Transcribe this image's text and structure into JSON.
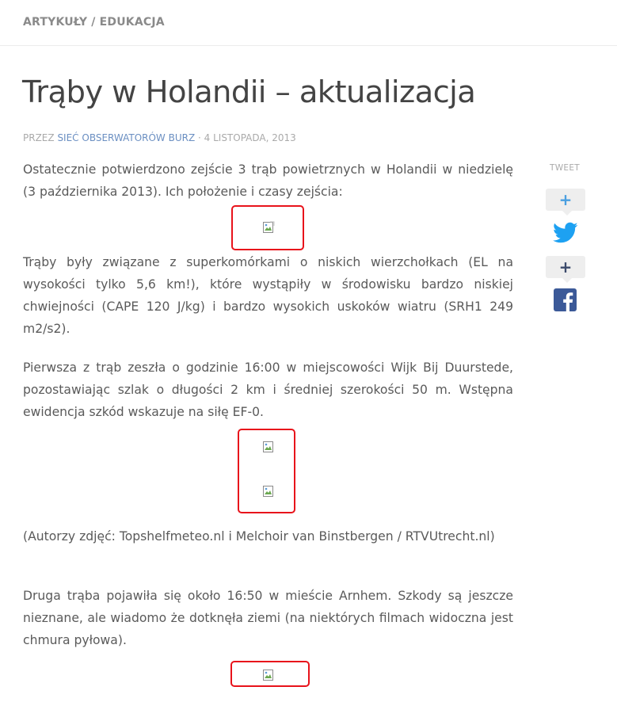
{
  "breadcrumb": "ARTYKUŁY / EDUKACJA",
  "article": {
    "title": "Trąby w Holandii – aktualizacja",
    "meta_prefix": "PRZEZ",
    "author": "SIEĆ OBSERWATORÓW BURZ",
    "meta_date": "· 4 LISTOPADA, 2013",
    "paragraphs": [
      "Ostatecznie potwierdzono zejście 3 trąb powietrznych w Holandii w niedzielę (3 października 2013). Ich położenie i czasy zejścia:",
      "Trąby były związane z superkomórkami o niskich wierzchołkach (EL na wysokości tylko 5,6 km!), które wystąpiły w środowisku bardzo niskiej chwiejności (CAPE 120 J/kg) i bardzo wysokich uskoków wiatru (SRH1 249 m2/s2).",
      "Pierwsza z trąb zeszła o godzinie 16:00 w miejscowości Wijk Bij Duurstede, pozostawiając szlak o długości 2 km i średniej szerokości 50 m. Wstępna ewidencja szkód wskazuje na siłę EF-0.",
      "(Autorzy zdjęć: Topshelfmeteo.nl i Melchoir van Binstbergen / RTVUtrecht.nl)",
      "Druga trąba pojawiła się około 16:50 w mieście Arnhem. Szkody są jeszcze nieznane, ale wiadomo że dotknęła ziemi (na niektórych filmach widoczna jest chmura pyłowa)."
    ]
  },
  "share": {
    "tweet_label": "TWEET",
    "plus_symbol": "+",
    "twitter_color": "#1da1f2",
    "facebook_color": "#3b5998",
    "icons": [
      "twitter-icon",
      "facebook-icon"
    ]
  },
  "colors": {
    "highlight_border": "#e8131b",
    "author_link": "#6b8fc2"
  }
}
